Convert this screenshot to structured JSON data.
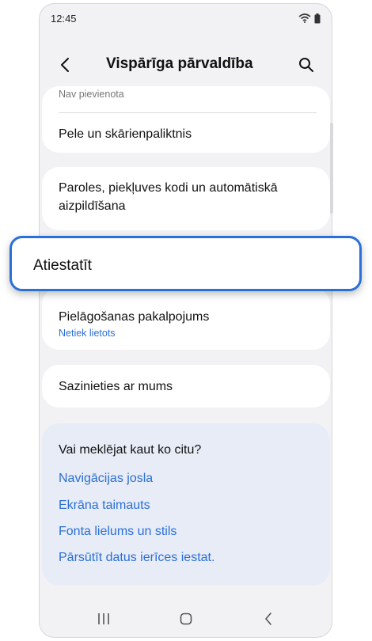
{
  "status_bar": {
    "time": "12:45"
  },
  "header": {
    "title": "Vispārīga pārvaldība"
  },
  "partial_row": {
    "value": "Nav pievienota"
  },
  "items": {
    "mouse": {
      "label": "Pele un skārienpaliktnis"
    },
    "passwords": {
      "line1": "Paroles, piekļuves kodi un automātiskā",
      "line2": "aizpildīšana"
    },
    "reset": {
      "label": "Atiestatīt"
    },
    "customization": {
      "label": "Pielāgošanas pakalpojums",
      "sub": "Netiek lietots"
    },
    "contact": {
      "label": "Sazinieties ar mums"
    }
  },
  "suggestions": {
    "title": "Vai meklējat kaut ko citu?",
    "links": [
      "Navigācijas josla",
      "Ekrāna taimauts",
      "Fonta lielums un stils",
      "Pārsūtīt datus ierīces iestat."
    ]
  },
  "colors": {
    "accent": "#2b6fd6",
    "highlight_border": "#2a70d8",
    "background": "#f2f2f5",
    "suggest_bg": "#e7ecf7"
  },
  "icons": [
    "wifi-icon",
    "battery-icon",
    "back-arrow-icon",
    "search-icon",
    "recents-icon",
    "home-icon",
    "nav-back-icon"
  ]
}
